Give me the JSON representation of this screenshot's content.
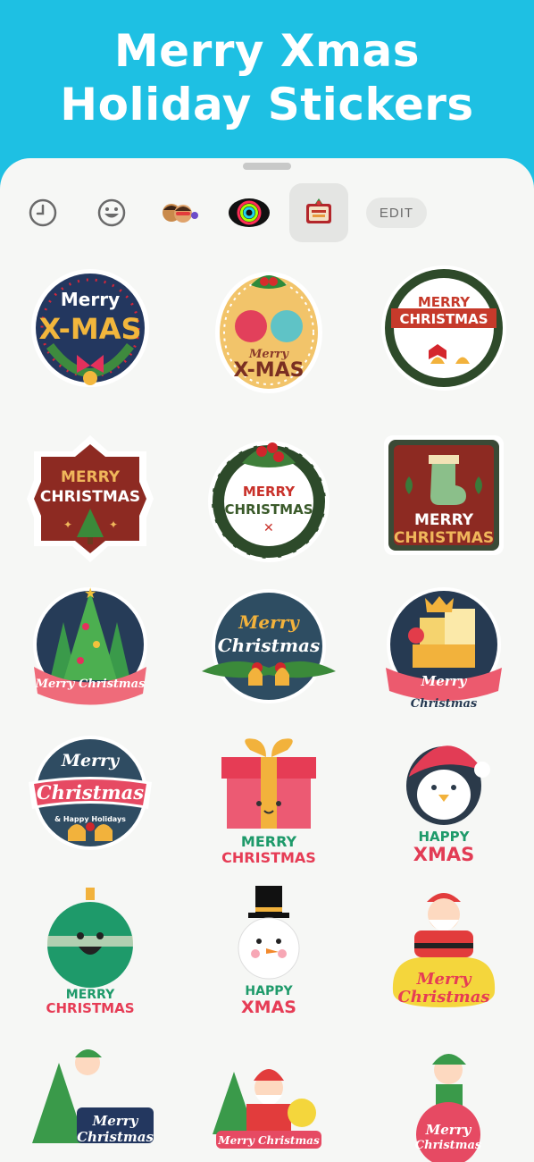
{
  "banner": {
    "line1": "Merry Xmas",
    "line2": "Holiday Stickers"
  },
  "tabs": [
    {
      "icon": "recent-clock-icon"
    },
    {
      "icon": "emoji-smiley-icon"
    },
    {
      "icon": "memoji-pack-icon"
    },
    {
      "icon": "ring-pack-icon"
    },
    {
      "icon": "christmas-pack-icon",
      "selected": true
    }
  ],
  "edit_label": "EDIT",
  "stickers": [
    {
      "l1": "Merry",
      "l2": "X-MAS"
    },
    {
      "l1": "Merry",
      "l2": "X-MAS"
    },
    {
      "l1": "MERRY",
      "l2": "CHRISTMAS"
    },
    {
      "l1": "MERRY",
      "l2": "CHRISTMAS"
    },
    {
      "l1": "MERRY",
      "l2": "CHRISTMAS"
    },
    {
      "l1": "MERRY",
      "l2": "CHRISTMAS"
    },
    {
      "l1": "Merry Christmas"
    },
    {
      "l1": "Merry",
      "l2": "Christmas"
    },
    {
      "l1": "Merry",
      "l2": "Christmas"
    },
    {
      "l1": "Merry",
      "l2": "Christmas",
      "l3": "& Happy Holidays"
    },
    {
      "l1": "MERRY",
      "l2": "CHRISTMAS"
    },
    {
      "l1": "HAPPY",
      "l2": "XMAS"
    },
    {
      "l1": "MERRY",
      "l2": "CHRISTMAS"
    },
    {
      "l1": "HAPPY",
      "l2": "XMAS"
    },
    {
      "l1": "Merry",
      "l2": "Christmas"
    },
    {
      "l1": "Merry",
      "l2": "Christmas"
    },
    {
      "l1": "Merry Christmas"
    },
    {
      "l1": "Merry",
      "l2": "Christmas"
    }
  ]
}
